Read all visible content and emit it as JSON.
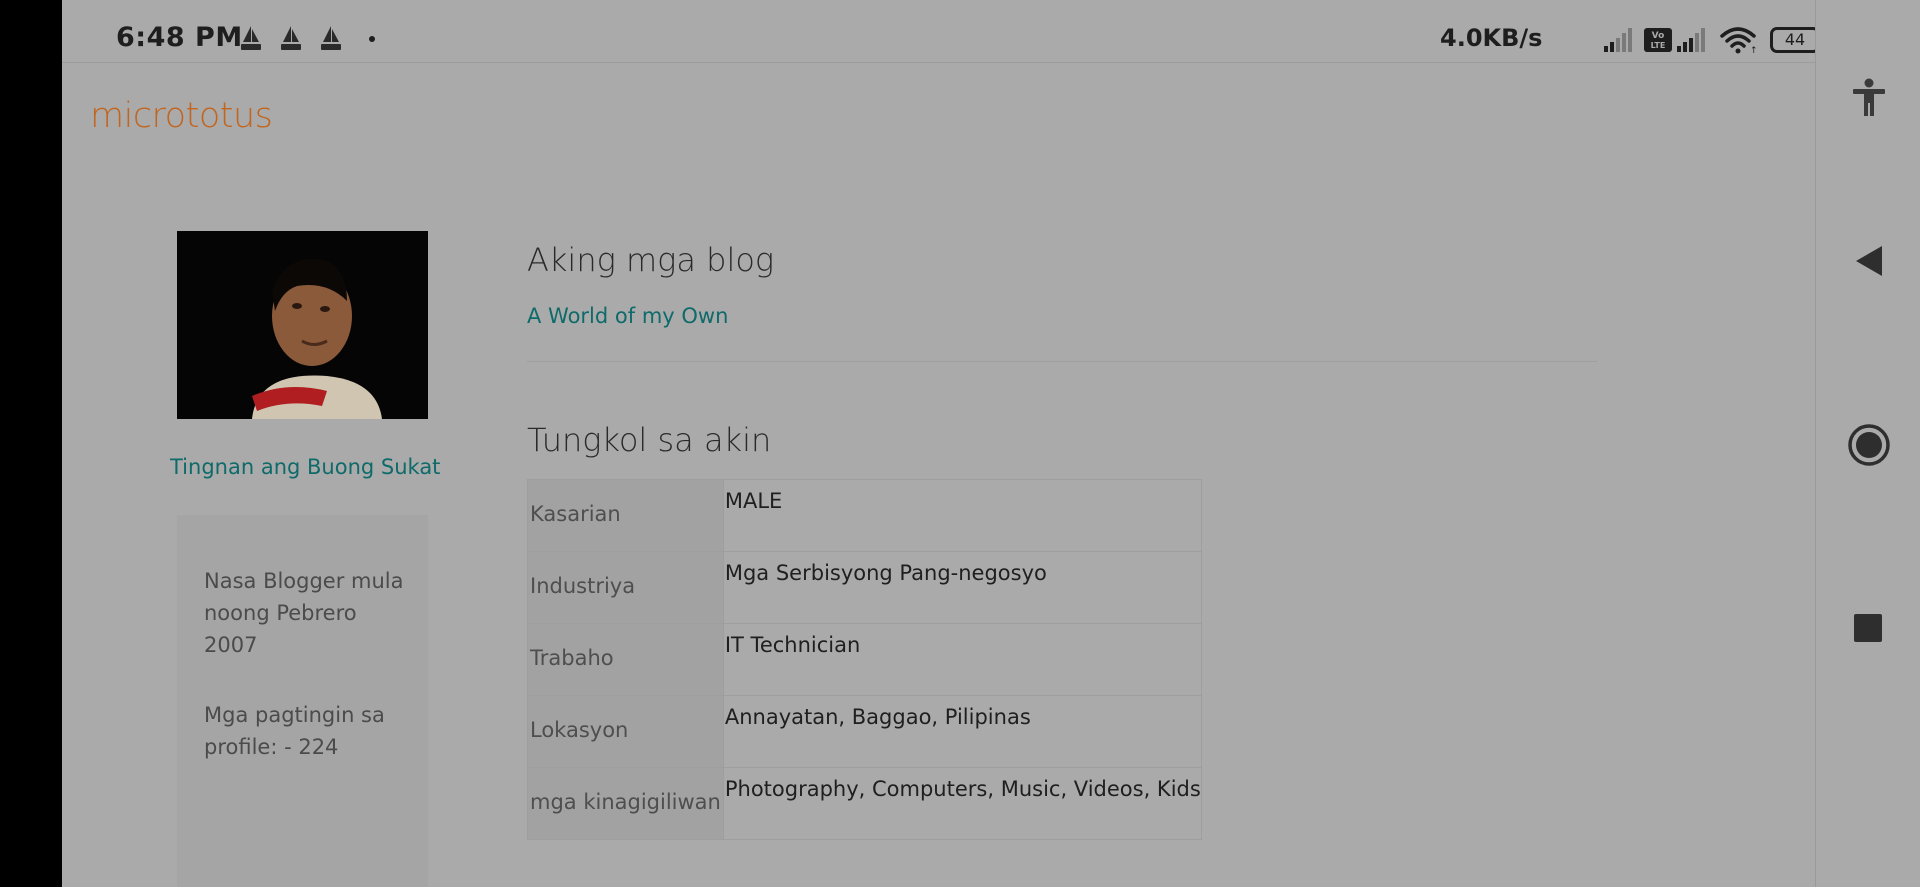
{
  "status_bar": {
    "time": "6:48 PM",
    "notification_icons": [
      "sailboat-notification-icon",
      "sailboat-notification-icon",
      "sailboat-notification-icon",
      "more-notifications-dot"
    ],
    "network_speed": "4.0KB/s",
    "battery_level": "44"
  },
  "site": {
    "title": "micrototus"
  },
  "profile": {
    "full_size_link": "Tingnan ang Buong Sukat",
    "member_since": "Nasa Blogger mula noong Pebrero 2007",
    "profile_views": "Mga pagtingin sa profile: - 224"
  },
  "blogs": {
    "heading": "Aking mga blog",
    "items": [
      {
        "title": "A World of my Own"
      }
    ]
  },
  "about": {
    "heading": "Tungkol sa akin",
    "rows": [
      {
        "label": "Kasarian",
        "value": "MALE"
      },
      {
        "label": "Industriya",
        "value": "Mga Serbisyong Pang-negosyo"
      },
      {
        "label": "Trabaho",
        "value": "IT Technician"
      },
      {
        "label": "Lokasyon",
        "value": "Annayatan, Baggao, Pilipinas"
      },
      {
        "label": "mga kinagigiliwan",
        "value": "Photography, Computers, Music, Videos, Kids"
      }
    ]
  },
  "nav_bar": {
    "buttons": [
      "accessibility-icon",
      "back-icon",
      "home-icon",
      "recents-icon"
    ]
  }
}
